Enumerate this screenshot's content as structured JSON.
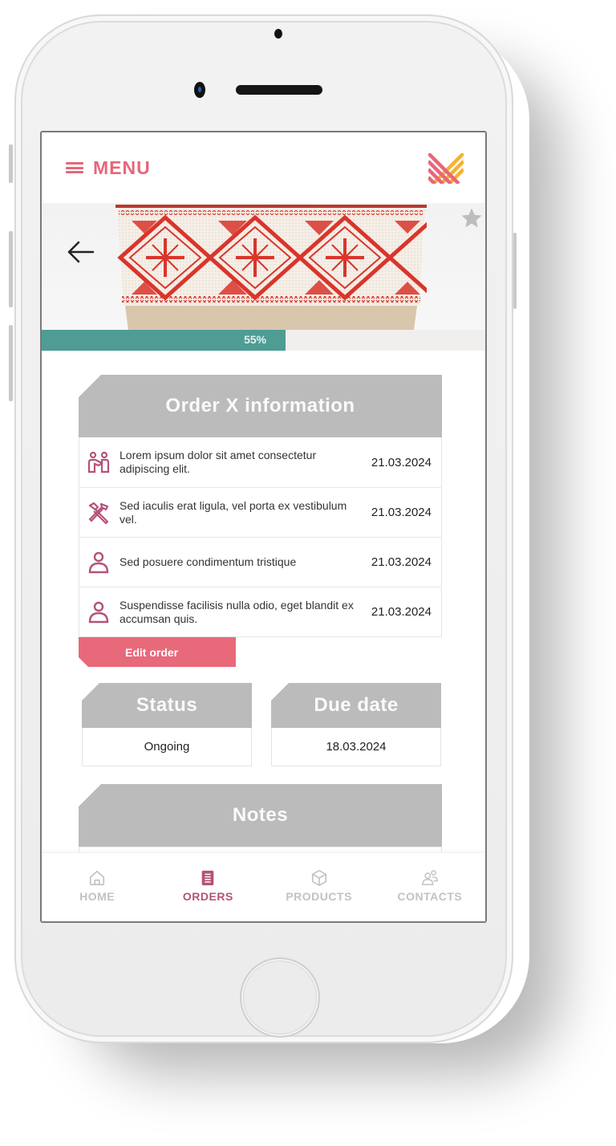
{
  "colors": {
    "accent": "#e8667a",
    "accent_dark": "#b5527a",
    "progress": "#4e9c94",
    "card_header": "#bbbbbb",
    "logo_pink": "#e8667a",
    "logo_yellow": "#f5b133"
  },
  "header": {
    "menu_label": "MENU",
    "menu_icon": "hamburger-icon",
    "logo_icon": "woven-logo-icon"
  },
  "hero": {
    "back_icon": "arrow-left-icon",
    "favorite_icon": "star-icon",
    "image_alt": "Red and white embroidered basket"
  },
  "progress": {
    "value": 55,
    "label": "55%"
  },
  "order_info": {
    "title": "Order X information",
    "rows": [
      {
        "icon": "handshake-icon",
        "text": "Lorem ipsum dolor sit amet consectetur adipiscing elit.",
        "date": "21.03.2024"
      },
      {
        "icon": "tools-icon",
        "text": "Sed iaculis erat ligula, vel porta ex vestibulum vel.",
        "date": "21.03.2024"
      },
      {
        "icon": "person-icon",
        "text": "Sed posuere condimentum tristique",
        "date": "21.03.2024"
      },
      {
        "icon": "person-icon",
        "text": "Suspendisse facilisis nulla odio, eget blandit ex accumsan quis.",
        "date": "21.03.2024"
      }
    ],
    "edit_label": "Edit order"
  },
  "status": {
    "title": "Status",
    "value": "Ongoing"
  },
  "due_date": {
    "title": "Due date",
    "value": "18.03.2024"
  },
  "notes": {
    "title": "Notes"
  },
  "bottom_nav": {
    "items": [
      {
        "label": "HOME",
        "icon": "home-icon",
        "active": false
      },
      {
        "label": "ORDERS",
        "icon": "orders-icon",
        "active": true
      },
      {
        "label": "PRODUCTS",
        "icon": "box-icon",
        "active": false
      },
      {
        "label": "CONTACTS",
        "icon": "contacts-icon",
        "active": false
      }
    ]
  }
}
